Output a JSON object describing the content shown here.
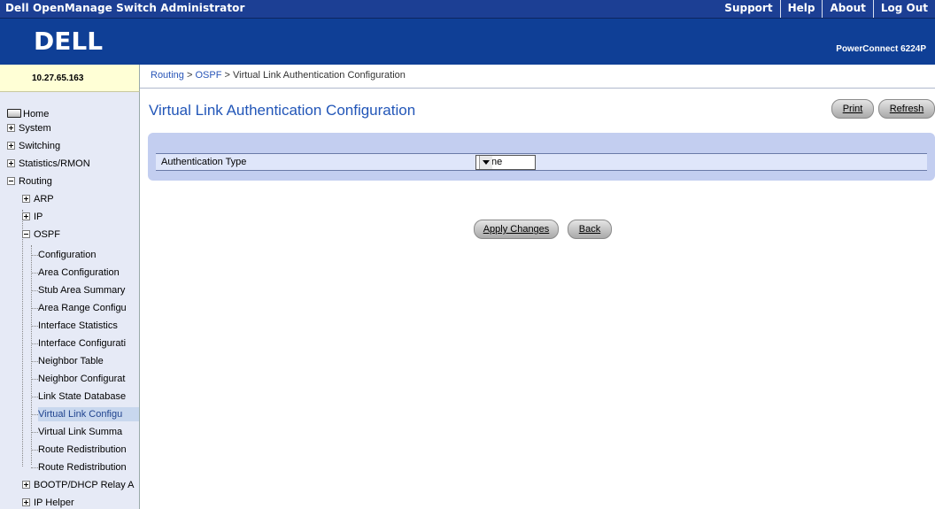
{
  "header": {
    "app_title": "Dell OpenManage Switch Administrator",
    "links": [
      "Support",
      "Help",
      "About",
      "Log Out"
    ],
    "brand": "DELL",
    "product": "PowerConnect 6224P"
  },
  "ip_address": "10.27.65.163",
  "breadcrumb": {
    "items": [
      "Routing",
      "OSPF"
    ],
    "separator": ">",
    "current": "Virtual Link Authentication Configuration"
  },
  "sidebar": {
    "home": "Home",
    "system": "System",
    "switching": "Switching",
    "statistics": "Statistics/RMON",
    "routing": "Routing",
    "arp": "ARP",
    "ip": "IP",
    "ospf": "OSPF",
    "ospf_items": [
      "Configuration",
      "Area Configuration",
      "Stub Area Summary",
      "Area Range Configu",
      "Interface Statistics",
      "Interface Configurati",
      "Neighbor Table",
      "Neighbor Configurat",
      "Link State Database",
      "Virtual Link Configu",
      "Virtual Link Summa",
      "Route Redistribution",
      "Route Redistribution"
    ],
    "bootp": "BOOTP/DHCP Relay A",
    "ip_helper": "IP Helper"
  },
  "main": {
    "title": "Virtual Link Authentication Configuration",
    "print_label": "Print",
    "refresh_label": "Refresh",
    "field_label": "Authentication Type",
    "field_value": "None",
    "apply_label": "Apply Changes",
    "back_label": "Back"
  },
  "colors": {
    "header_bar": "#1c3f94",
    "brand_bar": "#0f3f96",
    "link_blue": "#2256b8",
    "panel": "#c3cef0",
    "sidebar": "#e6eaf6",
    "ip_box": "#ffffd6"
  }
}
